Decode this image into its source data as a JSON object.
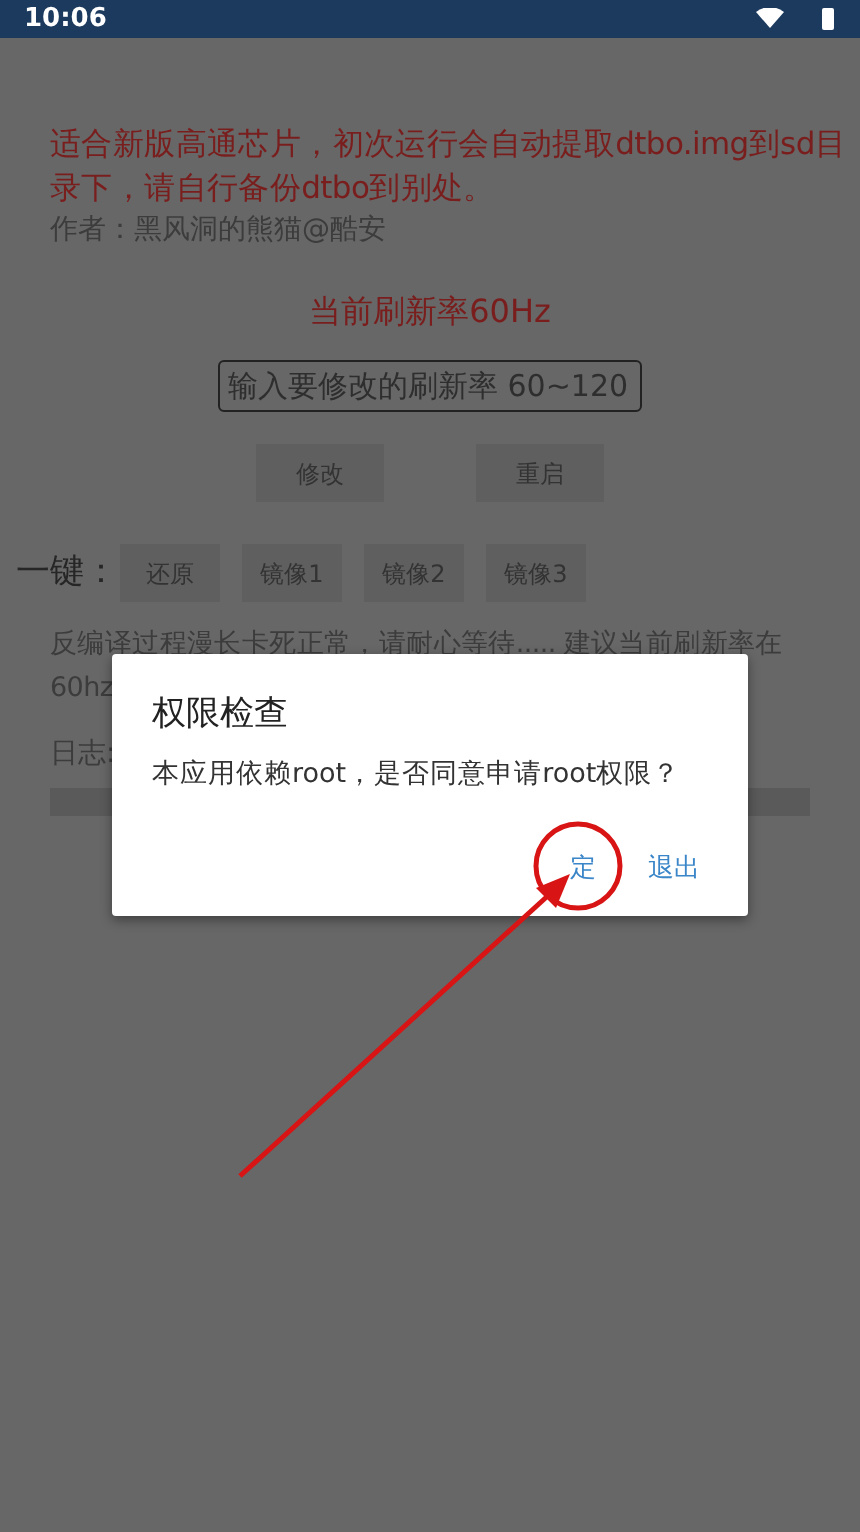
{
  "status_bar": {
    "time": "10:06"
  },
  "notice": "适合新版高通芯片，初次运行会自动提取dtbo.img到sd目录下，请自行备份dtbo到别处。",
  "author": "作者：黑风洞的熊猫@酷安",
  "current_rate": "当前刷新率60Hz",
  "rate_field": {
    "placeholder": "输入要修改的刷新率 60~120"
  },
  "buttons": [
    "修改",
    "重启"
  ],
  "one_key": {
    "label": "一键：",
    "buttons": [
      "还原",
      "镜像1",
      "镜像2",
      "镜像3"
    ]
  },
  "hint_lines": [
    "反编译过程漫长卡死正常，请耐心等待..... 建议当前刷新率在",
    "60hz"
  ],
  "log_label": "日志:",
  "dialog": {
    "title": "权限检查",
    "message": "本应用依赖root，是否同意申请root权限？",
    "buttons": [
      "定",
      "退出"
    ]
  }
}
